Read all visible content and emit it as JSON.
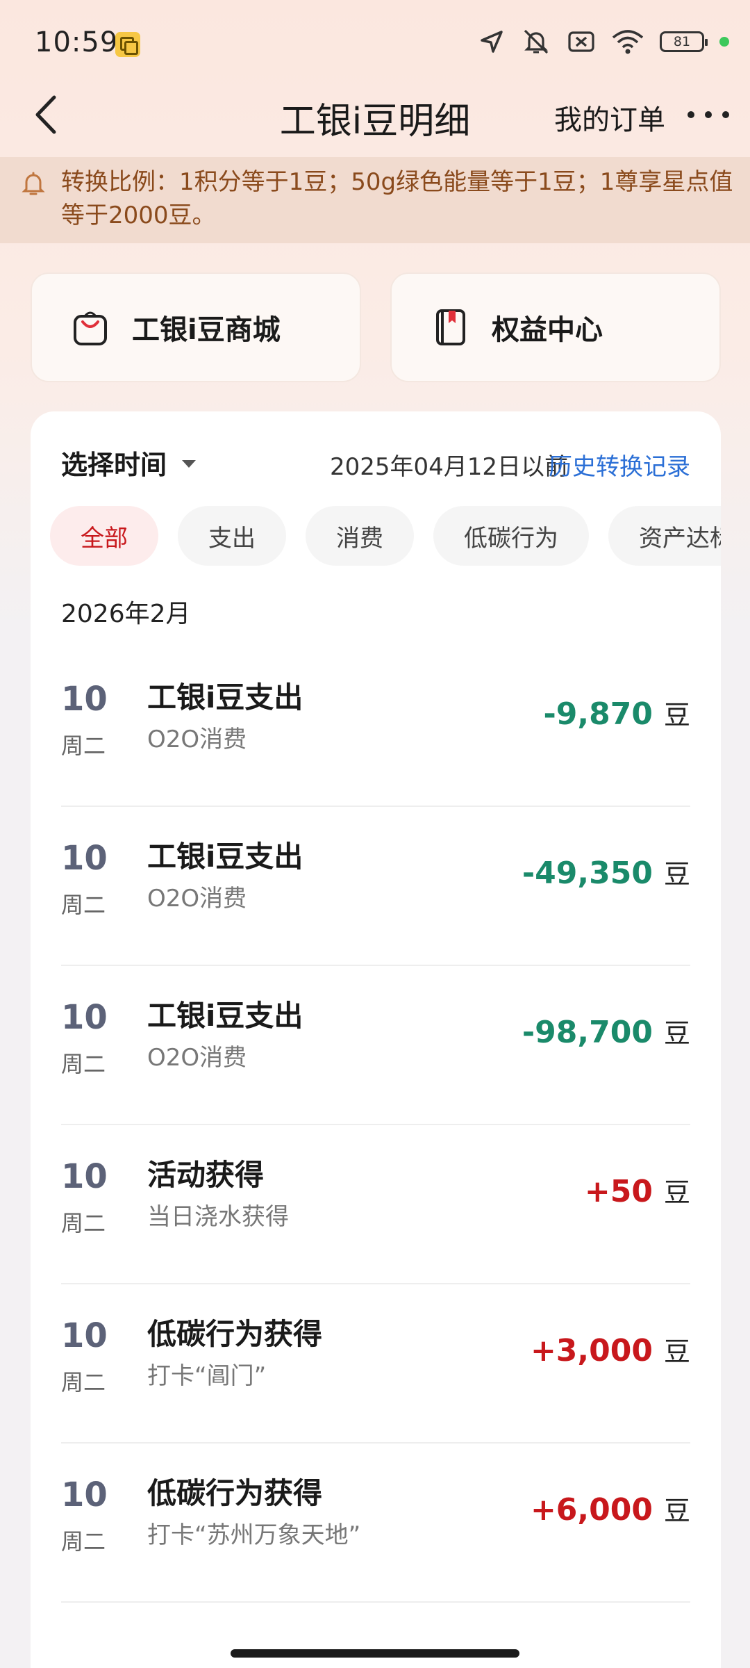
{
  "status_bar": {
    "time": "10:59",
    "battery": "81",
    "icons": [
      "location-icon",
      "mute-icon",
      "no-sim-icon",
      "wifi-icon",
      "battery-icon"
    ]
  },
  "nav": {
    "title": "工银i豆明细",
    "my_orders": "我的订单"
  },
  "notice": {
    "text": "转换比例：1积分等于1豆；50g绿色能量等于1豆；1尊享星点值等于2000豆。"
  },
  "shortcuts": [
    {
      "label": "工银i豆商城",
      "icon": "shopping-bag-icon"
    },
    {
      "label": "权益中心",
      "icon": "bookmark-book-icon"
    }
  ],
  "filter": {
    "time_select": "选择时间",
    "since": "2025年04月12日以前",
    "history_link": "历史转换记录"
  },
  "chips": [
    {
      "label": "全部",
      "active": true
    },
    {
      "label": "支出",
      "active": false
    },
    {
      "label": "消费",
      "active": false
    },
    {
      "label": "低碳行为",
      "active": false
    },
    {
      "label": "资产达标",
      "active": false
    }
  ],
  "month_label": "2026年2月",
  "unit": "豆",
  "transactions": [
    {
      "day": "10",
      "weekday": "周二",
      "title": "工银i豆支出",
      "subtitle": "O2O消费",
      "amount": "-9,870",
      "type": "neg"
    },
    {
      "day": "10",
      "weekday": "周二",
      "title": "工银i豆支出",
      "subtitle": "O2O消费",
      "amount": "-49,350",
      "type": "neg"
    },
    {
      "day": "10",
      "weekday": "周二",
      "title": "工银i豆支出",
      "subtitle": "O2O消费",
      "amount": "-98,700",
      "type": "neg"
    },
    {
      "day": "10",
      "weekday": "周二",
      "title": "活动获得",
      "subtitle": "当日浇水获得",
      "amount": "+50",
      "type": "pos"
    },
    {
      "day": "10",
      "weekday": "周二",
      "title": "低碳行为获得",
      "subtitle": "打卡“阊门”",
      "amount": "+3,000",
      "type": "pos"
    },
    {
      "day": "10",
      "weekday": "周二",
      "title": "低碳行为获得",
      "subtitle": "打卡“苏州万象天地”",
      "amount": "+6,000",
      "type": "pos"
    }
  ],
  "colors": {
    "accent_red": "#c8181c",
    "expense_green": "#1a8a6a",
    "link_blue": "#2b6fd6",
    "notice_bg": "#f1dbcf",
    "notice_text": "#8a4a1c"
  }
}
